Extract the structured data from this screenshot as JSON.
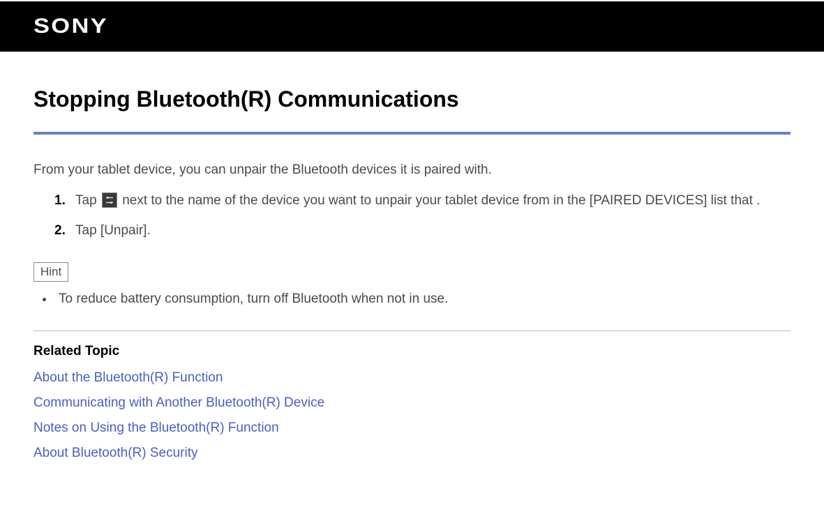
{
  "header": {
    "logo_text": "SONY"
  },
  "title": "Stopping Bluetooth(R) Communications",
  "intro": "From your tablet device, you can unpair the Bluetooth devices it is paired with.",
  "steps": [
    {
      "before_icon": "Tap ",
      "after_icon": " next to the name of the device you want to unpair your tablet device from in the [PAIRED DEVICES] list that ."
    },
    {
      "text": "Tap [Unpair]."
    }
  ],
  "hint": {
    "label": "Hint",
    "items": [
      "To reduce battery consumption, turn off Bluetooth when not in use."
    ]
  },
  "related": {
    "heading": "Related Topic",
    "links": [
      "About the Bluetooth(R) Function",
      "Communicating with Another Bluetooth(R) Device",
      "Notes on Using the Bluetooth(R) Function",
      "About Bluetooth(R) Security"
    ]
  }
}
